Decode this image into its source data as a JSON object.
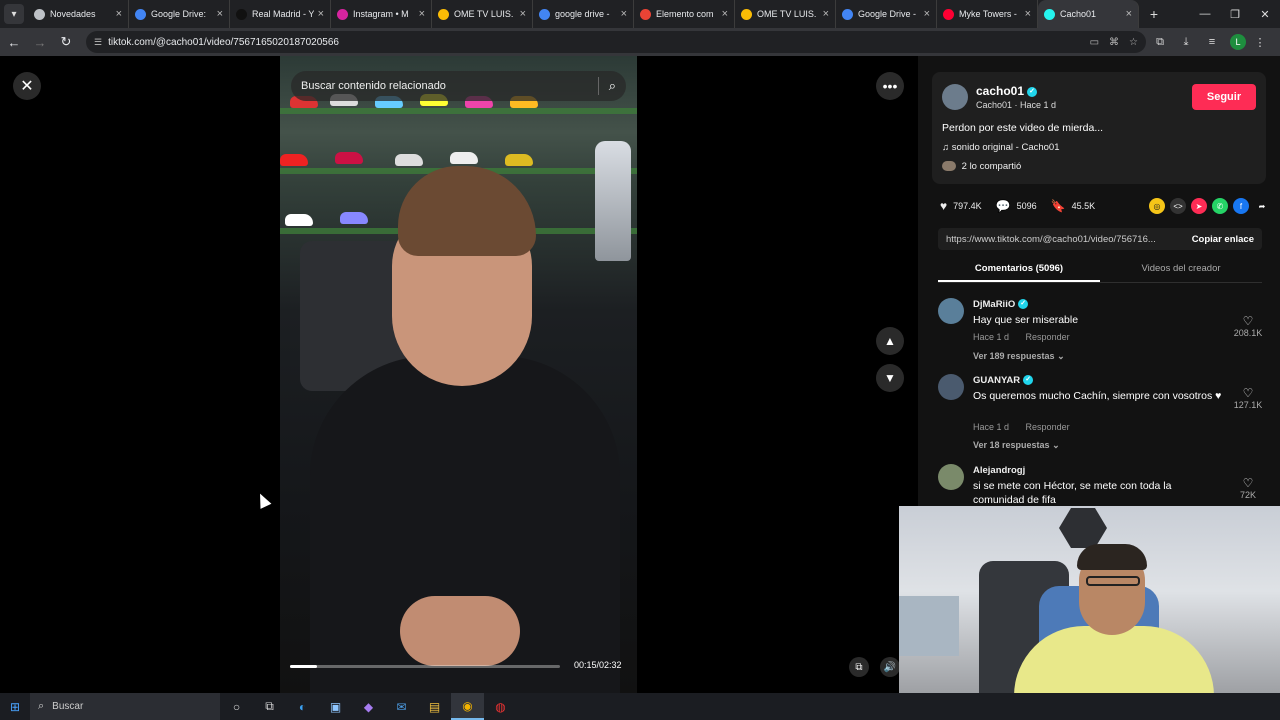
{
  "browser": {
    "tabs": [
      {
        "label": "Novedades",
        "color": "#bdc1c6"
      },
      {
        "label": "Google Drive: ",
        "color": "#4285f4"
      },
      {
        "label": "Real Madrid - Y",
        "color": "#111111"
      },
      {
        "label": "Instagram • M",
        "color": "#d6249f"
      },
      {
        "label": "OME TV LUIS.",
        "color": "#fbbc05"
      },
      {
        "label": "google drive - ",
        "color": "#4285f4"
      },
      {
        "label": "Elemento com",
        "color": "#ea4335"
      },
      {
        "label": "OME TV LUIS.",
        "color": "#fbbc05"
      },
      {
        "label": "Google Drive -",
        "color": "#4285f4"
      },
      {
        "label": "Myke Towers -",
        "color": "#ff0033"
      },
      {
        "label": "Cacho01",
        "color": "#25f4ee"
      }
    ],
    "url": "tiktok.com/@cacho01/video/7567165020187020566",
    "profile_initial": "L"
  },
  "video": {
    "search_placeholder": "Buscar contenido relacionado",
    "progress": 0.099,
    "time": "00:15/02:32"
  },
  "author": {
    "name": "cacho01",
    "sub": "Cacho01 · Hace 1 d",
    "follow_label": "Seguir",
    "caption": "Perdon por este video de mierda...",
    "music": "sonido original - Cacho01",
    "shared": "2 lo compartió"
  },
  "stats": {
    "likes": "797.4K",
    "comments": "5096",
    "saves": "45.5K"
  },
  "share_link": {
    "url": "https://www.tiktok.com/@cacho01/video/756716...",
    "copy_label": "Copiar enlace"
  },
  "panel_tabs": {
    "comments": "Comentarios (5096)",
    "creator_videos": "Videos del creador"
  },
  "comments": [
    {
      "user": "DjMaRiiO",
      "text": "Hay que ser miserable",
      "time": "Hace 1 d",
      "reply": "Responder",
      "replies": "Ver 189 respuestas",
      "likes": "208.1K"
    },
    {
      "user": "GUANYAR",
      "text": "Os queremos mucho Cachín, siempre con vosotros ♥",
      "time": "Hace 1 d",
      "reply": "Responder",
      "replies": "Ver 18 respuestas",
      "likes": "127.1K"
    },
    {
      "user": "Alejandrogj",
      "text": "si se mete con Héctor, se mete con toda la comunidad de fifa",
      "time": "",
      "reply": "",
      "replies": "",
      "likes": "72K"
    }
  ],
  "taskbar": {
    "search_label": "Buscar"
  }
}
